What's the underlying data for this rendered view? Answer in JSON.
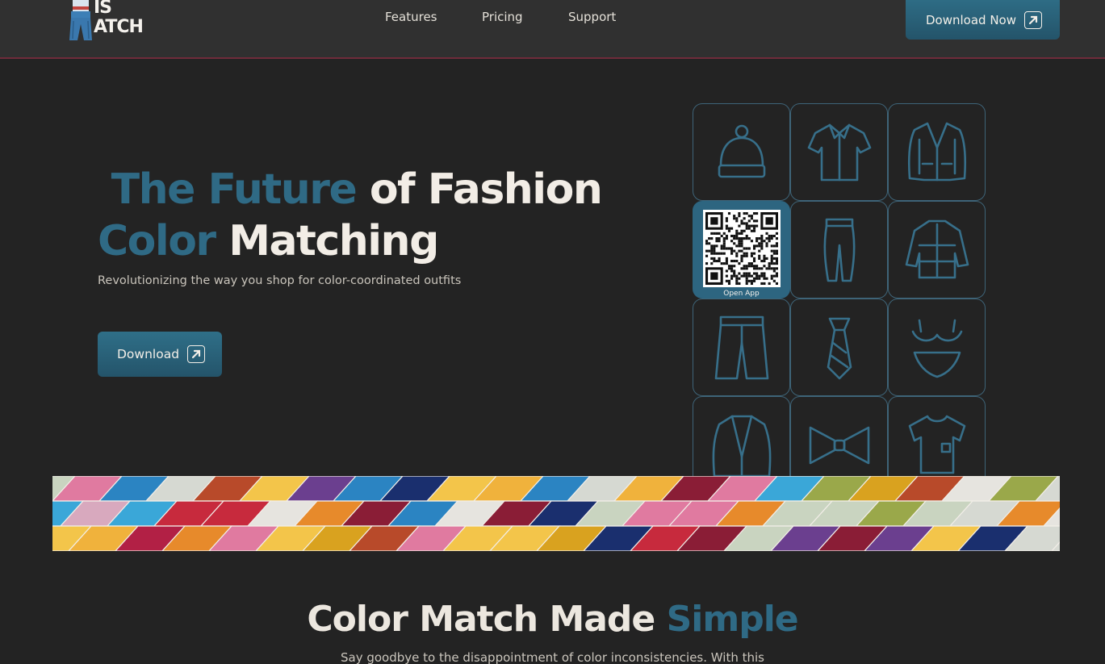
{
  "header": {
    "logo_line1": "IS",
    "logo_line2": "ATCH",
    "nav": [
      "Features",
      "Pricing",
      "Support"
    ],
    "download_label": "Download Now"
  },
  "hero": {
    "title_accent_1": "The Future",
    "title_rest_1": " of Fashion",
    "title_accent_2": "Color",
    "title_rest_2": " Matching",
    "subtitle": "Revolutionizing the way you shop for color-coordinated outfits",
    "download_label": "Download"
  },
  "grid": {
    "items": [
      "beanie-icon",
      "shirt-icon",
      "cardigan-icon",
      "qr-code",
      "leggings-icon",
      "puffer-jacket-icon",
      "shorts-icon",
      "tie-icon",
      "swimsuit-icon",
      "blazer-icon",
      "bow-tie-icon",
      "t-shirt-icon"
    ],
    "qr_label": "Open App"
  },
  "section_two": {
    "title_main": "Color Match Made ",
    "title_accent": "Simple",
    "subtitle": "Say goodbye to the disappointment of color inconsistencies. With this"
  },
  "colors": {
    "background": "#232323",
    "header": "#303030",
    "accent": "#2f6a85",
    "text": "#ece7df"
  }
}
